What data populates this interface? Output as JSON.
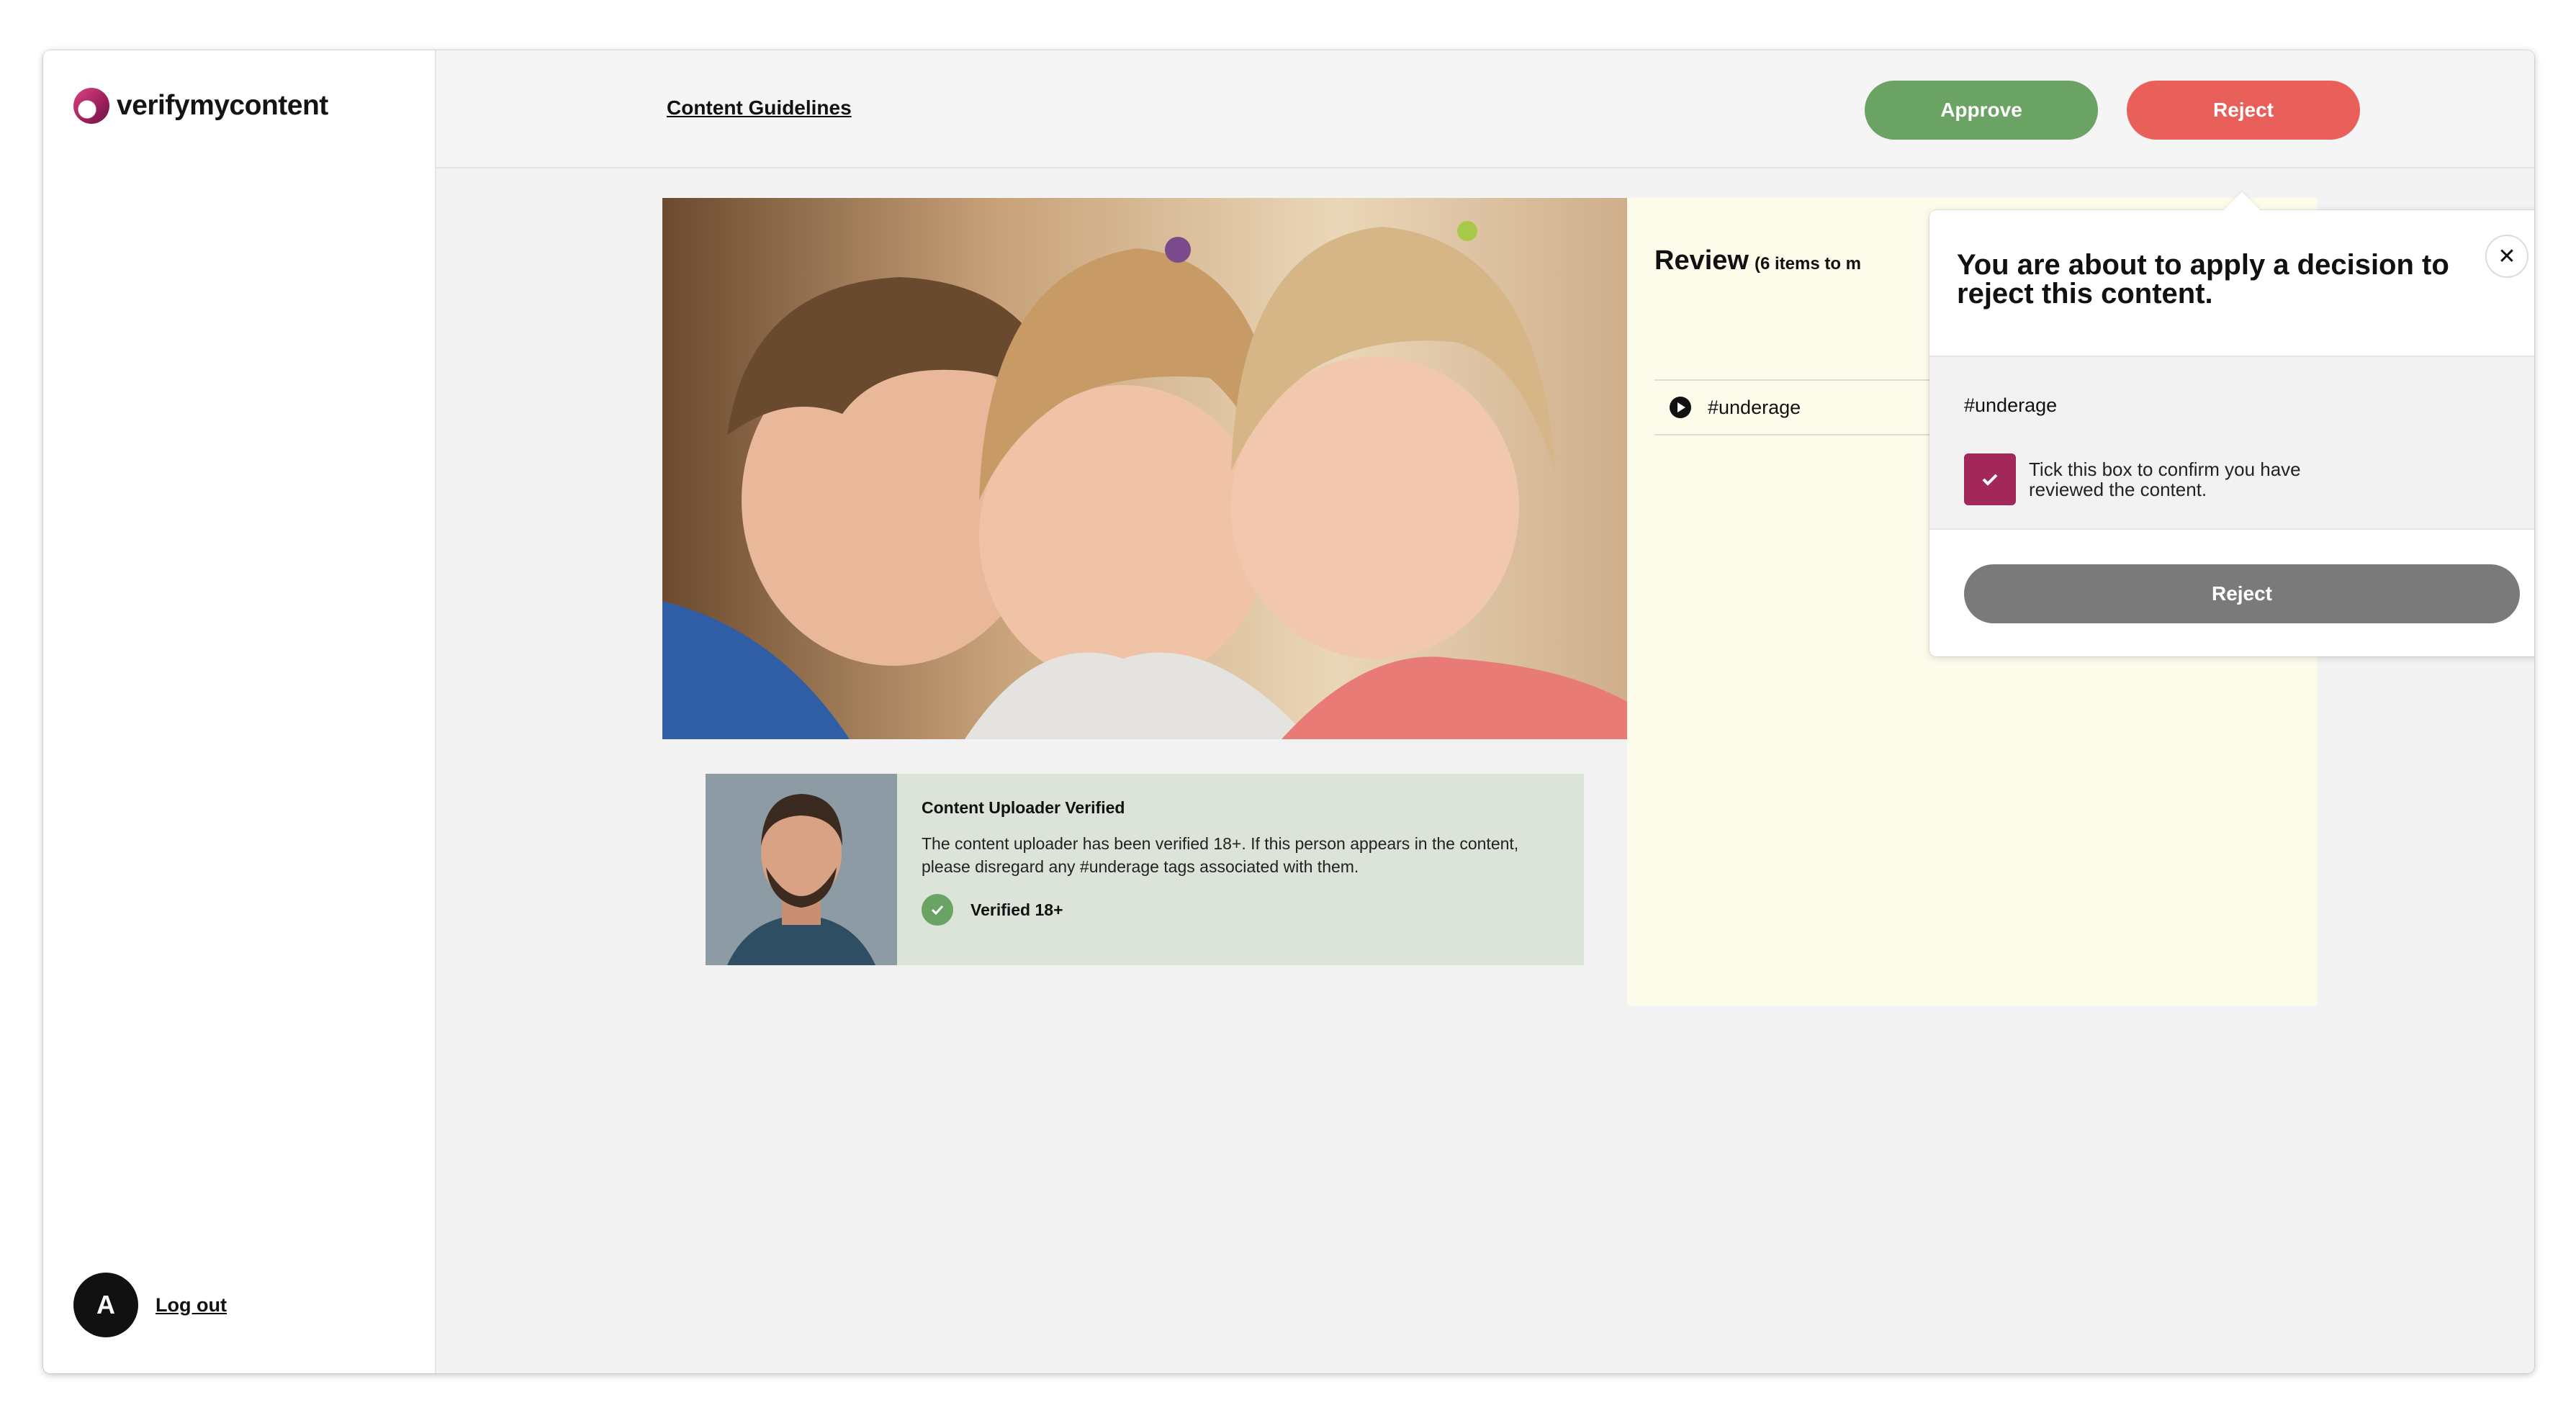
{
  "brand": {
    "name": "verifymycontent",
    "accent": "#a3285a"
  },
  "sidebar": {
    "user_initial": "A",
    "logout_label": "Log out"
  },
  "header": {
    "guidelines_link": "Content Guidelines",
    "approve_label": "Approve",
    "reject_label": "Reject",
    "approve_color": "#6aa363",
    "reject_color": "#e9605a"
  },
  "content": {
    "uploader": {
      "title": "Content Uploader Verified",
      "description": "The content uploader has been verified 18+. If this person appears in the content, please disregard any #underage tags associated with them.",
      "verified_label": "Verified 18+"
    }
  },
  "review": {
    "title": "Review",
    "count_text": "(6 items to m",
    "tags": [
      "#underage"
    ]
  },
  "modal": {
    "title": "You are about to apply a decision to reject this content.",
    "tag": "#underage",
    "confirm_text": "Tick this box to confirm you have reviewed the content.",
    "confirm_checked": true,
    "submit_label": "Reject"
  }
}
